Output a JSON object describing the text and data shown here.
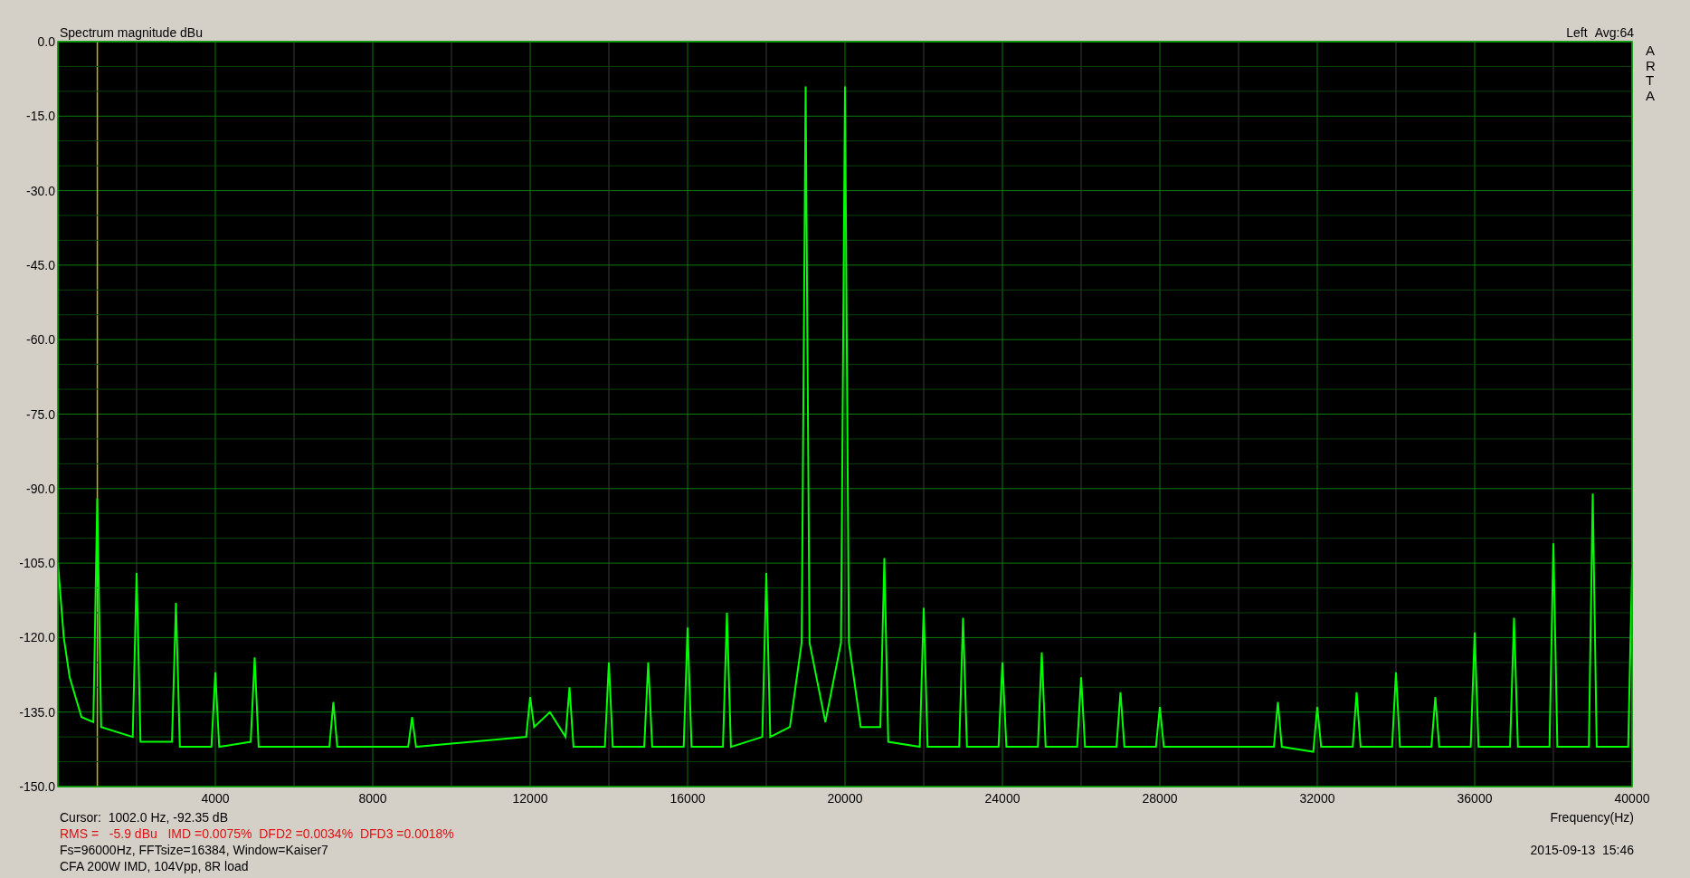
{
  "header": {
    "title": "Spectrum magnitude dBu",
    "averaging": "Avg:64"
  },
  "brand": "ARTA",
  "chart_data": {
    "type": "line",
    "xlabel": "Frequency(Hz)",
    "xlim": [
      0,
      40000
    ],
    "ylim": [
      -150,
      0
    ],
    "xticks": [
      4000,
      8000,
      12000,
      16000,
      20000,
      24000,
      28000,
      32000,
      36000,
      40000
    ],
    "yticks": [
      {
        "value": 0,
        "label": "0.0"
      },
      {
        "value": -15,
        "label": "-15.0"
      },
      {
        "value": -30,
        "label": "-30.0"
      },
      {
        "value": -45,
        "label": "-45.0"
      },
      {
        "value": -60,
        "label": "-60.0"
      },
      {
        "value": -75,
        "label": "-75.0"
      },
      {
        "value": -90,
        "label": "-90.0"
      },
      {
        "value": -105,
        "label": "-105.0"
      },
      {
        "value": -120,
        "label": "-120.0"
      },
      {
        "value": -135,
        "label": "-135.0"
      },
      {
        "value": -150,
        "label": "-150.0"
      }
    ],
    "x": [
      0,
      150,
      300,
      600,
      900,
      1000,
      1100,
      1900,
      2000,
      2100,
      2900,
      3000,
      3100,
      3900,
      4000,
      4100,
      4900,
      5000,
      5100,
      6900,
      7000,
      7100,
      8900,
      9000,
      9100,
      11900,
      12000,
      12100,
      12500,
      12900,
      13000,
      13100,
      13900,
      14000,
      14100,
      14900,
      15000,
      15100,
      15900,
      16000,
      16100,
      16900,
      17000,
      17100,
      17900,
      18000,
      18100,
      18600,
      18900,
      19000,
      19100,
      19500,
      19900,
      20000,
      20100,
      20400,
      20900,
      21000,
      21100,
      21900,
      22000,
      22100,
      22900,
      23000,
      23100,
      23900,
      24000,
      24100,
      24900,
      25000,
      25100,
      25900,
      26000,
      26100,
      26900,
      27000,
      27100,
      27900,
      28000,
      28100,
      30900,
      31000,
      31100,
      31900,
      32000,
      32100,
      32900,
      33000,
      33100,
      33900,
      34000,
      34100,
      34900,
      35000,
      35100,
      35900,
      36000,
      36100,
      36900,
      37000,
      37100,
      37900,
      38000,
      38100,
      38900,
      39000,
      39100,
      39900,
      40000
    ],
    "series": [
      {
        "name": "Left",
        "color": "#00ff00",
        "values": [
          -105,
          -120,
          -128,
          -136,
          -137,
          -92,
          -138,
          -140,
          -107,
          -141,
          -141,
          -113,
          -142,
          -142,
          -127,
          -142,
          -141,
          -124,
          -142,
          -142,
          -133,
          -142,
          -142,
          -136,
          -142,
          -140,
          -132,
          -138,
          -135,
          -140,
          -130,
          -142,
          -142,
          -125,
          -142,
          -142,
          -125,
          -142,
          -142,
          -118,
          -142,
          -142,
          -115,
          -142,
          -140,
          -107,
          -140,
          -138,
          -121,
          -9,
          -121,
          -137,
          -121,
          -9,
          -121,
          -138,
          -138,
          -104,
          -141,
          -142,
          -114,
          -142,
          -142,
          -116,
          -142,
          -142,
          -125,
          -142,
          -142,
          -123,
          -142,
          -142,
          -128,
          -142,
          -142,
          -131,
          -142,
          -142,
          -134,
          -142,
          -142,
          -133,
          -142,
          -143,
          -134,
          -142,
          -142,
          -131,
          -142,
          -142,
          -127,
          -142,
          -142,
          -132,
          -142,
          -142,
          -119,
          -142,
          -142,
          -116,
          -142,
          -142,
          -101,
          -142,
          -142,
          -91,
          -142,
          -142,
          -106
        ]
      }
    ],
    "grid": true,
    "ref_lines": [
      {
        "axis": "x",
        "value": 1002,
        "color": "#c8b400"
      },
      {
        "axis": "y",
        "value": -5,
        "color": "#0a420a"
      },
      {
        "axis": "y",
        "value": -10,
        "color": "#0a420a"
      },
      {
        "axis": "y",
        "value": -20,
        "color": "#0a420a"
      },
      {
        "axis": "y",
        "value": -25,
        "color": "#0a420a"
      },
      {
        "axis": "y",
        "value": -35,
        "color": "#0a420a"
      },
      {
        "axis": "y",
        "value": -40,
        "color": "#0a420a"
      },
      {
        "axis": "y",
        "value": -50,
        "color": "#0a420a"
      },
      {
        "axis": "y",
        "value": -55,
        "color": "#0a420a"
      },
      {
        "axis": "y",
        "value": -65,
        "color": "#0a420a"
      },
      {
        "axis": "y",
        "value": -70,
        "color": "#0a420a"
      },
      {
        "axis": "y",
        "value": -80,
        "color": "#0a420a"
      },
      {
        "axis": "y",
        "value": -85,
        "color": "#0a420a"
      },
      {
        "axis": "y",
        "value": -95,
        "color": "#0a420a"
      },
      {
        "axis": "y",
        "value": -100,
        "color": "#0a420a"
      },
      {
        "axis": "y",
        "value": -110,
        "color": "#0a420a"
      },
      {
        "axis": "y",
        "value": -115,
        "color": "#0a420a"
      },
      {
        "axis": "y",
        "value": -125,
        "color": "#0a420a"
      },
      {
        "axis": "y",
        "value": -130,
        "color": "#0a420a"
      },
      {
        "axis": "y",
        "value": -140,
        "color": "#0a420a"
      },
      {
        "axis": "y",
        "value": -145,
        "color": "#0a420a"
      }
    ]
  },
  "readouts": [
    {
      "text": "Cursor:  1002.0 Hz, -92.35 dB",
      "kind": "normal"
    },
    {
      "text": "RMS =   -5.9 dBu   IMD =0.0075%  DFD2 =0.0034%  DFD3 =0.0018%",
      "kind": "alert"
    },
    {
      "text": "Fs=96000Hz, FFTsize=16384, Window=Kaiser7",
      "kind": "normal"
    },
    {
      "text": "CFA 200W IMD, 104Vpp, 8R load",
      "kind": "normal"
    }
  ],
  "timestamp": "2015-09-13  15:46"
}
